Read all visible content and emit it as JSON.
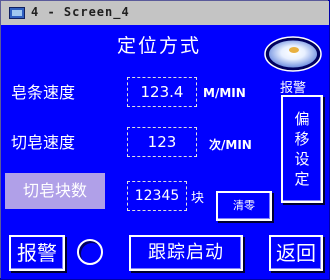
{
  "window": {
    "title": "4 - Screen_4"
  },
  "screen": {
    "title": "定位方式"
  },
  "fields": {
    "soap_speed": {
      "label": "皂条速度",
      "value": "123.4",
      "unit": "M/MIN"
    },
    "cut_speed": {
      "label": "切皂速度",
      "value": "123",
      "unit": "次/MIN"
    },
    "cut_count": {
      "label": "切皂块数",
      "value": "12345",
      "unit": "块"
    }
  },
  "alarm_lamp": {
    "label": "报警"
  },
  "buttons": {
    "offset_setting": [
      "偏",
      "移",
      "设",
      "定"
    ],
    "clear": "清零",
    "alarm": "报警",
    "track_start": "跟踪启动",
    "back": "返回"
  },
  "colors": {
    "background": "#0000ff",
    "highlight_label": "#b0a0e8",
    "title_bar": "#c4c4c4"
  }
}
